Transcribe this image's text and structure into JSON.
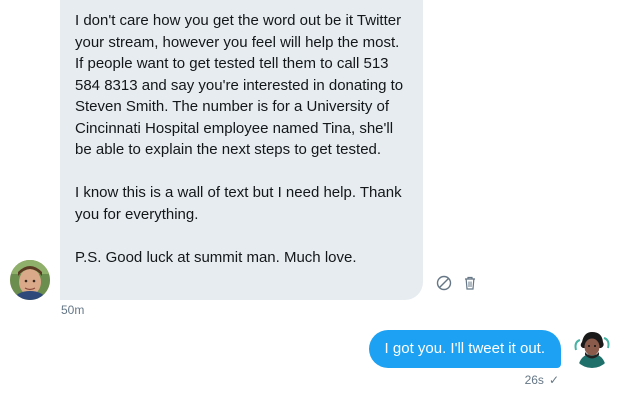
{
  "conversation": {
    "incoming": {
      "paragraphs": [
        "I don't care how you get the word out be it Twitter your stream, however you feel will help the most. If people want to get tested tell them to call 513 584 8313 and say you're interested in donating to Steven Smith. The number is for a University of Cincinnati Hospital employee named Tina, she'll be able to explain the next steps to get tested.",
        "I know this is a wall of text but I need help. Thank you for everything.",
        "P.S. Good luck at summit man. Much love."
      ],
      "time": "50m",
      "actions": {
        "report_icon": "block-icon",
        "delete_icon": "trash-icon"
      }
    },
    "outgoing": {
      "text": "I got you. I'll tweet it out.",
      "time": "26s",
      "status_icon": "check-icon",
      "status_glyph": "✓"
    }
  },
  "colors": {
    "incoming_bubble": "#e6ecf0",
    "outgoing_bubble": "#1da1f2",
    "meta_text": "#657786"
  }
}
